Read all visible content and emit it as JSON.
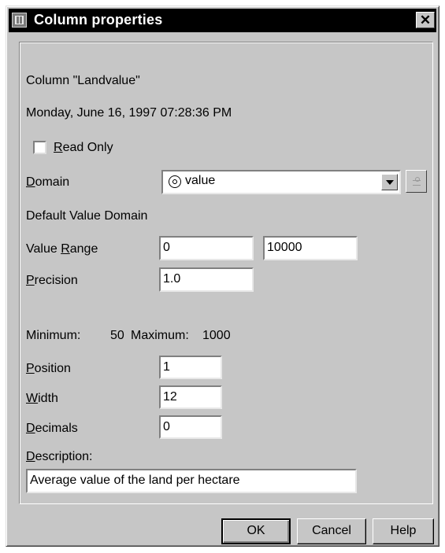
{
  "window": {
    "title": "Column properties",
    "close_glyph": "✕"
  },
  "column_label": "Column \"Landvalue\"",
  "timestamp": "Monday, June 16, 1997 07:28:36 PM",
  "read_only": {
    "mnemonic": "R",
    "rest": "ead Only",
    "checked": false
  },
  "domain": {
    "mnemonic": "D",
    "rest": "omain",
    "selected": "value",
    "icon": "domain-value-icon"
  },
  "default_domain_text": "Default Value Domain",
  "value_range": {
    "label_pre": "Value ",
    "mnemonic": "R",
    "rest": "ange",
    "min": "0",
    "max": "10000"
  },
  "precision": {
    "mnemonic": "P",
    "rest": "recision",
    "value": "1.0"
  },
  "stats": {
    "min_label": "Minimum:",
    "min_value": "50",
    "max_label": "Maximum:",
    "max_value": "1000"
  },
  "position": {
    "mnemonic": "P",
    "rest": "osition",
    "value": "1"
  },
  "width": {
    "mnemonic": "W",
    "rest": "idth",
    "value": "12"
  },
  "decimals": {
    "mnemonic": "D",
    "rest": "ecimals",
    "value": "0"
  },
  "description": {
    "mnemonic": "D",
    "rest": "escription:",
    "value": "Average value of the land per hectare"
  },
  "buttons": {
    "ok": "OK",
    "cancel": "Cancel",
    "help": "Help"
  }
}
